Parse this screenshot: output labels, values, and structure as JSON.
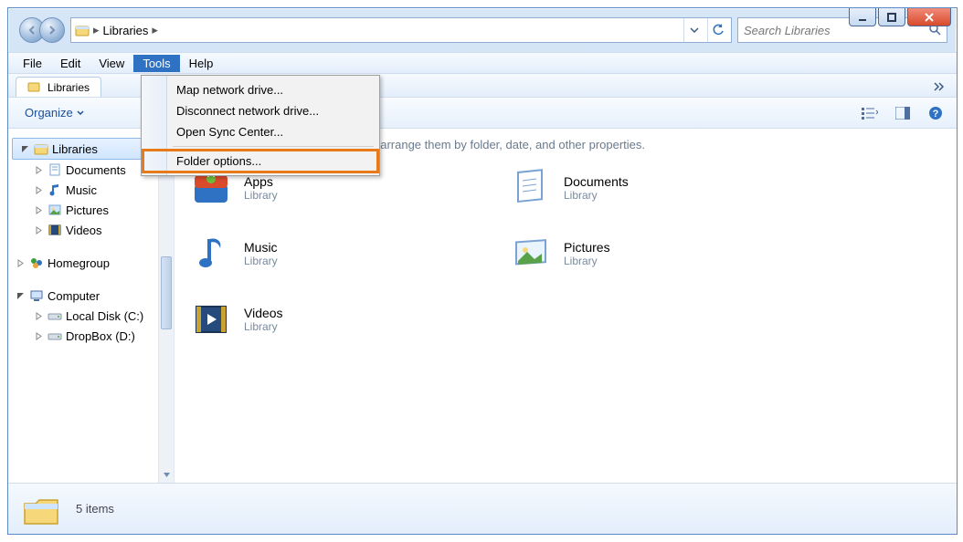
{
  "window_controls": {
    "minimize": "minimize",
    "maximize": "maximize",
    "close": "close"
  },
  "address": {
    "location_label": "Libraries",
    "search_placeholder": "Search Libraries"
  },
  "menubar": {
    "items": [
      "File",
      "Edit",
      "View",
      "Tools",
      "Help"
    ],
    "open_index": 3
  },
  "tools_menu": {
    "items": [
      "Map network drive...",
      "Disconnect network drive...",
      "Open Sync Center..."
    ],
    "highlighted": "Folder options..."
  },
  "tabs": {
    "active": "Libraries"
  },
  "toolbar": {
    "organize_label": "Organize"
  },
  "tree": {
    "libraries": {
      "label": "Libraries",
      "children": [
        "Documents",
        "Music",
        "Pictures",
        "Videos"
      ]
    },
    "homegroup": "Homegroup",
    "computer": {
      "label": "Computer",
      "children": [
        "Local Disk (C:)",
        "DropBox (D:)"
      ]
    }
  },
  "content": {
    "hint": "Open a library to see your files and arrange them by folder, date, and other properties.",
    "sublabel": "Library",
    "items": [
      "Apps",
      "Documents",
      "Music",
      "Pictures",
      "Videos"
    ]
  },
  "status": {
    "count_label": "5 items"
  }
}
